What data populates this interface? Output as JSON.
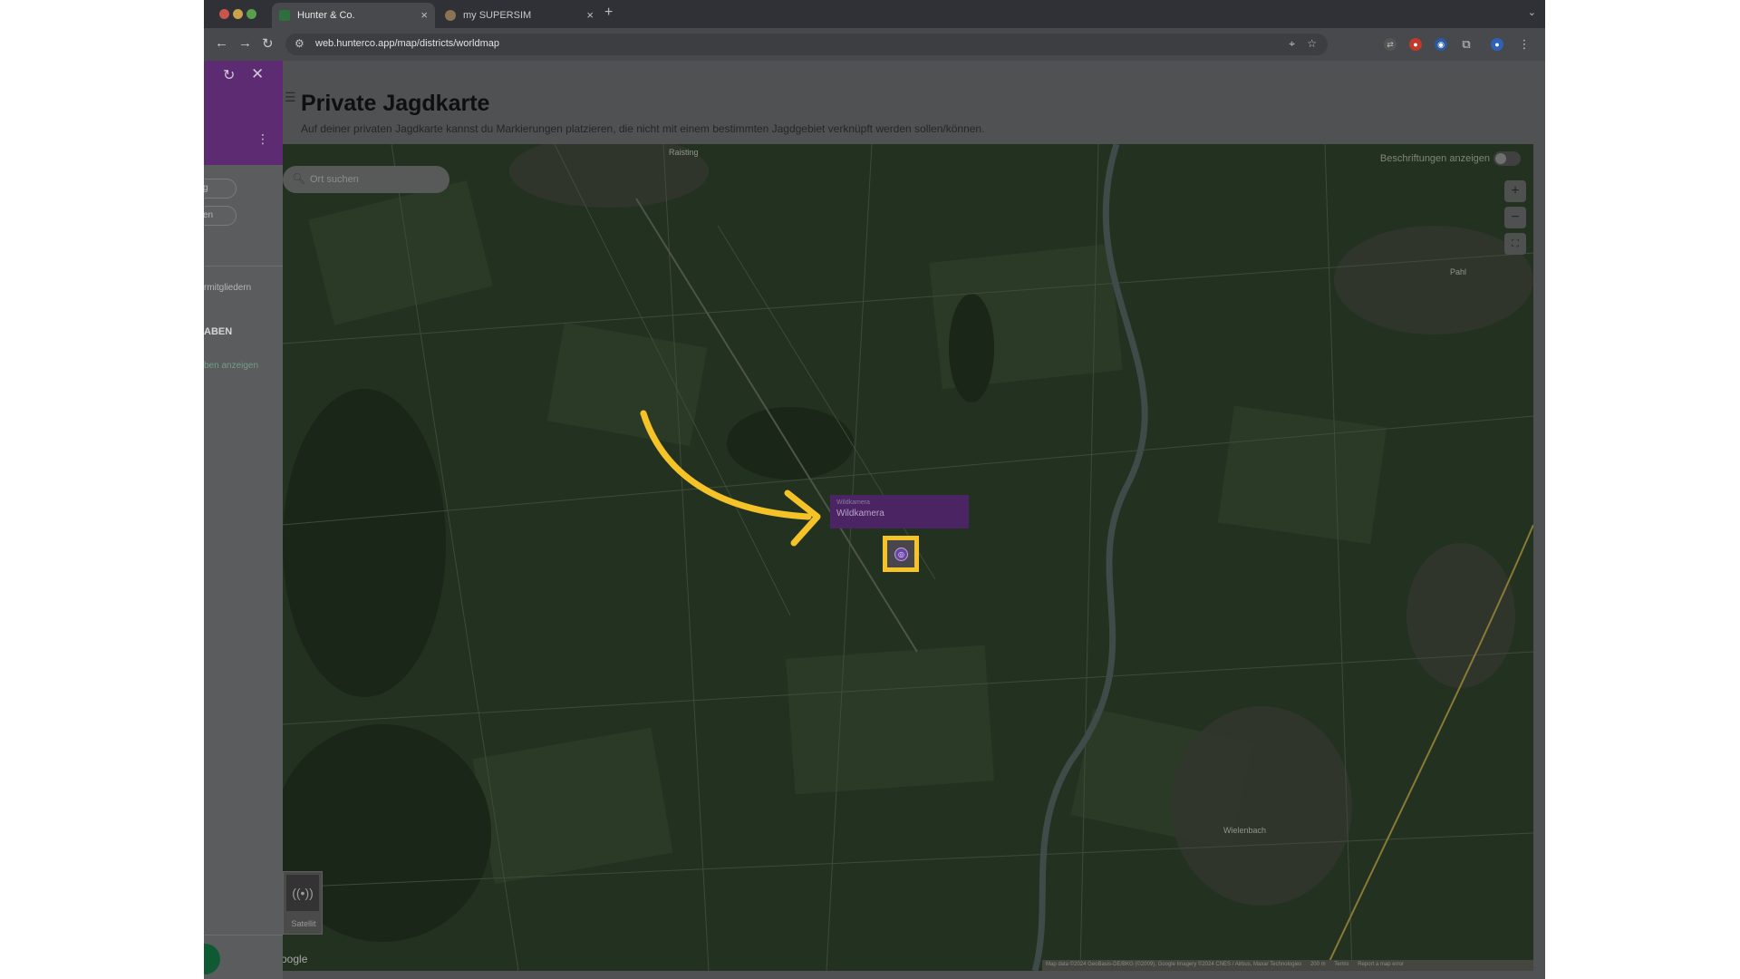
{
  "colors": {
    "brand_purple": "#5c2b72",
    "highlight_yellow": "#f5c227",
    "sidebar_link_green": "#6f9e89",
    "fab_green": "#0f5a33",
    "map_field": "#243220"
  },
  "browser": {
    "tabs": [
      {
        "label": "Hunter & Co.",
        "icon": "hunterco-favicon",
        "active": true
      },
      {
        "label": "my SUPERSIM",
        "icon": "supersim-favicon",
        "active": false
      }
    ],
    "new_tab_icon": "+",
    "url": "web.hunterco.app/map/districts/worldmap"
  },
  "sidebar": {
    "chip_1": "g",
    "chip_2": "en",
    "members_text": "rmitgliedern",
    "section_title": "ABEN",
    "link_text": "ben anzeigen"
  },
  "page": {
    "title": "Private Jagdkarte",
    "subtitle": "Auf deiner privaten Jagdkarte kannst du Markierungen platzieren, die nicht mit einem bestimmten Jagdgebiet verknüpft werden sollen/können."
  },
  "map": {
    "search_placeholder": "Ort suchen",
    "labels_toggle": "Beschriftungen anzeigen",
    "labels_on": false,
    "zoom_in": "+",
    "zoom_out": "−",
    "popup_small": "Wildkamera",
    "popup_name": "Wildkamera",
    "marker_icon": "camera-marker-icon",
    "map_type": "Satellit",
    "google_logo": "oogle",
    "attribution": {
      "data": "Map data ©2024 GeoBasis-DE/BKG (©2009), Google Imagery ©2024 CNES / Airbus, Maxar Technologies",
      "scale": "200 m",
      "terms": "Terms",
      "report": "Report a map error"
    },
    "towns": {
      "raisting": "Raisting",
      "pahl": "Pahl",
      "wielenbach": "Wielenbach"
    }
  }
}
